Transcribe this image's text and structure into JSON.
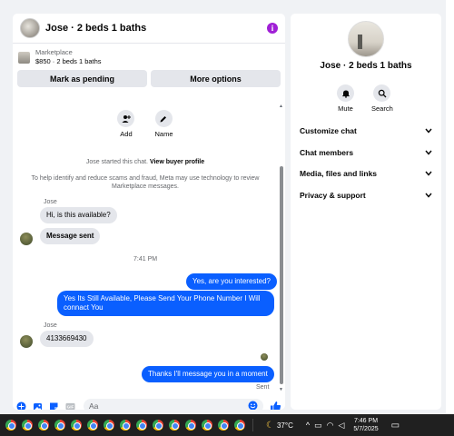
{
  "chat": {
    "title": "Jose · 2 beds 1 baths",
    "listing": {
      "category": "Marketplace",
      "price_title": "$850 · 2 beds 1 baths"
    },
    "actions": {
      "mark_pending": "Mark as pending",
      "more_options": "More options"
    },
    "contact_actions": [
      {
        "label": "Add",
        "icon": "add-person-icon"
      },
      {
        "label": "Name",
        "icon": "pencil-icon"
      }
    ],
    "system": {
      "started_text": "Jose started this chat.",
      "view_profile": "View buyer profile",
      "disclaimer_line1": "To help identify and reduce scams and fraud, Meta may use technology to review",
      "disclaimer_line2": "Marketplace messages."
    },
    "messages": [
      {
        "sender": "Jose",
        "text": "Hi, is this available?",
        "direction": "in"
      },
      {
        "text": "Message sent",
        "direction": "in"
      },
      {
        "timestamp": "7:41 PM"
      },
      {
        "text": "Yes, are you interested?",
        "direction": "out"
      },
      {
        "text_line1": "Yes Its Still Available, Please Send Your Phone Number I Will",
        "text_line2": "connact You",
        "direction": "out"
      },
      {
        "sender": "Jose",
        "text": "4133669430",
        "direction": "in"
      },
      {
        "text": "Thanks I'll message you in a moment",
        "direction": "out",
        "status": "Sent"
      }
    ],
    "composer": {
      "placeholder": "Aa"
    }
  },
  "side": {
    "name": "Jose · 2 beds 1 baths",
    "actions": [
      {
        "label": "Mute",
        "icon": "bell-icon"
      },
      {
        "label": "Search",
        "icon": "search-icon"
      }
    ],
    "sections": [
      "Customize chat",
      "Chat members",
      "Media, files and links",
      "Privacy & support"
    ]
  },
  "taskbar": {
    "weather": "37°C",
    "time": "7:46 PM",
    "date": "5/7/2025"
  },
  "colors": {
    "accent": "#0a5fff",
    "info": "#a01fd6",
    "taskbar": "#202020"
  }
}
